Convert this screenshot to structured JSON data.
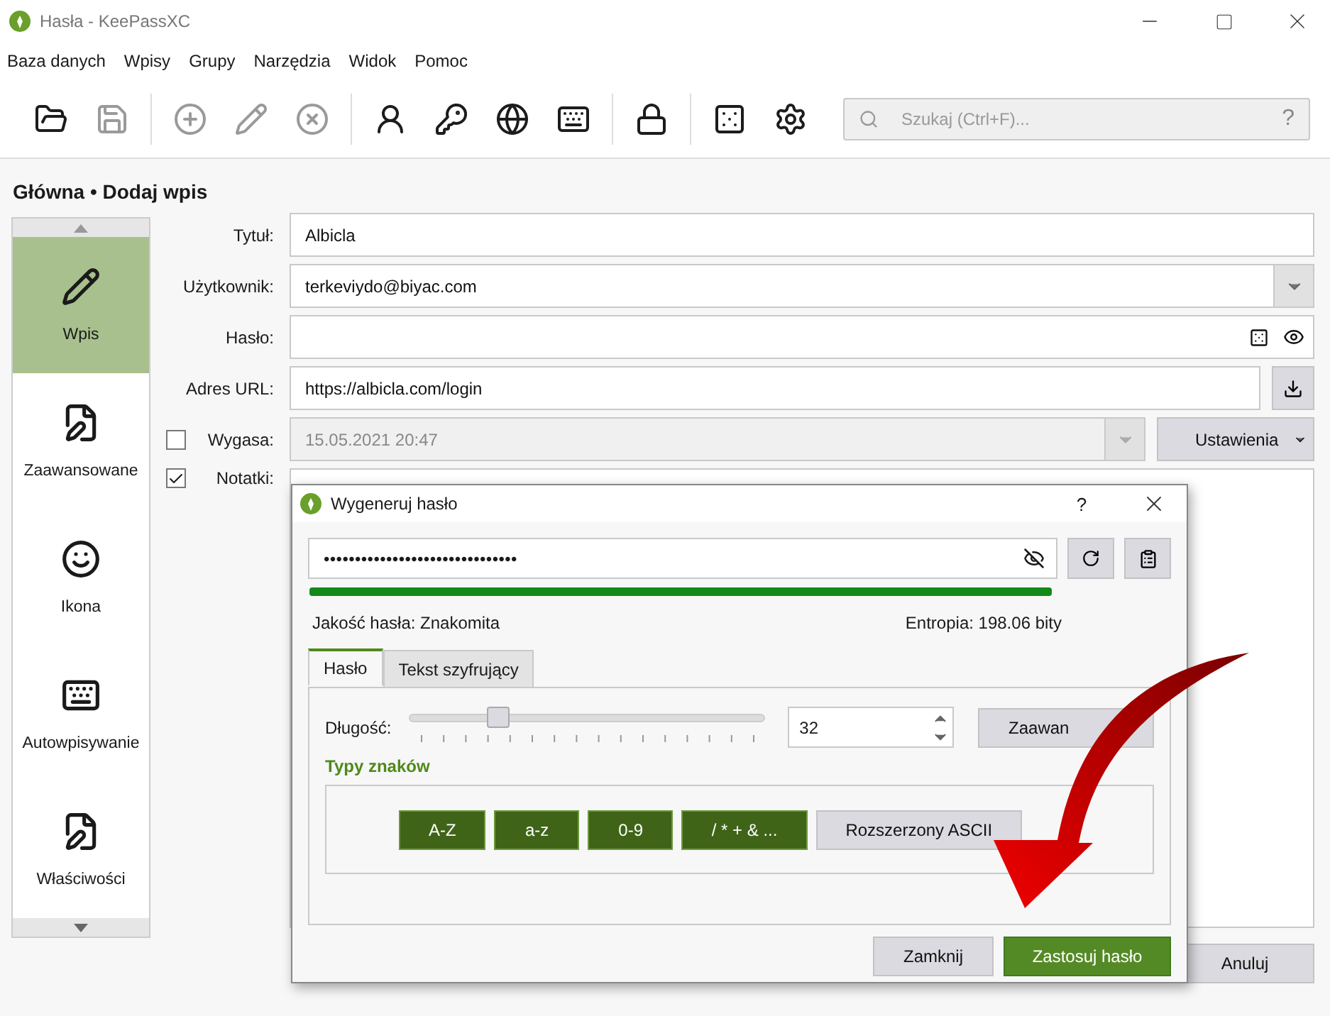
{
  "window": {
    "title": "Hasła - KeePassXC"
  },
  "menu": [
    "Baza danych",
    "Wpisy",
    "Grupy",
    "Narzędzia",
    "Widok",
    "Pomoc"
  ],
  "toolbar": [
    [
      {
        "kind": "folder",
        "disabled": false
      },
      {
        "kind": "save",
        "disabled": true
      }
    ],
    [
      {
        "kind": "add",
        "disabled": true
      },
      {
        "kind": "edit",
        "disabled": true
      },
      {
        "kind": "delete",
        "disabled": true
      }
    ],
    [
      {
        "kind": "user",
        "disabled": false
      },
      {
        "kind": "key",
        "disabled": false
      },
      {
        "kind": "globe",
        "disabled": false
      },
      {
        "kind": "keyboard",
        "disabled": false
      }
    ],
    [
      {
        "kind": "lock",
        "disabled": false
      }
    ],
    [
      {
        "kind": "dice",
        "disabled": false
      },
      {
        "kind": "gear",
        "disabled": false
      }
    ]
  ],
  "search": {
    "placeholder": "Szukaj (Ctrl+F)...",
    "help": "?"
  },
  "breadcrumb": "Główna • Dodaj wpis",
  "sidebar": [
    {
      "label": "Wpis",
      "kind": "pencil",
      "selected": true
    },
    {
      "label": "Zaawansowane",
      "kind": "doc",
      "selected": false
    },
    {
      "label": "Ikona",
      "kind": "smile",
      "selected": false
    },
    {
      "label": "Autowpisywanie",
      "kind": "keyboard",
      "selected": false
    },
    {
      "label": "Właściwości",
      "kind": "doc",
      "selected": false
    }
  ],
  "form": {
    "title": {
      "label": "Tytuł:",
      "value": "Albicla"
    },
    "username": {
      "label": "Użytkownik:",
      "value": "terkeviydo@biyac.com"
    },
    "password": {
      "label": "Hasło:"
    },
    "url": {
      "label": "Adres URL:",
      "value": "https://albicla.com/login"
    },
    "expires": {
      "label": "Wygasa:",
      "checked": false,
      "value": "15.05.2021 20:47",
      "settings": "Ustawienia"
    },
    "notes": {
      "label": "Notatki:",
      "checked": true
    },
    "cancel": "Anuluj"
  },
  "dialog": {
    "title": "Wygeneruj hasło",
    "help": "?",
    "password": "•••••••••••••••••••••••••••••••",
    "strength": {
      "level": 1
    },
    "quality": "Jakość hasła: Znakomita",
    "entropy": "Entropia: 198.06 bity",
    "tabs": [
      {
        "label": "Hasło",
        "selected": true
      },
      {
        "label": "Tekst szyfrujący",
        "selected": false
      }
    ],
    "length": {
      "label": "Długość:",
      "level": 0.25,
      "value": "32"
    },
    "advanced": "Zaawan",
    "char_types_title": "Typy znaków",
    "char_types": [
      {
        "label": "A-Z",
        "selected": true
      },
      {
        "label": "a-z",
        "selected": true
      },
      {
        "label": "0-9",
        "selected": true
      },
      {
        "label": "/ * + & ...",
        "selected": true
      },
      {
        "label": "Rozszerzony ASCII",
        "selected": false
      }
    ],
    "buttons": [
      {
        "label": "Zamknij",
        "kind": "plain"
      },
      {
        "label": "Zastosuj hasło",
        "kind": "primary"
      }
    ]
  }
}
